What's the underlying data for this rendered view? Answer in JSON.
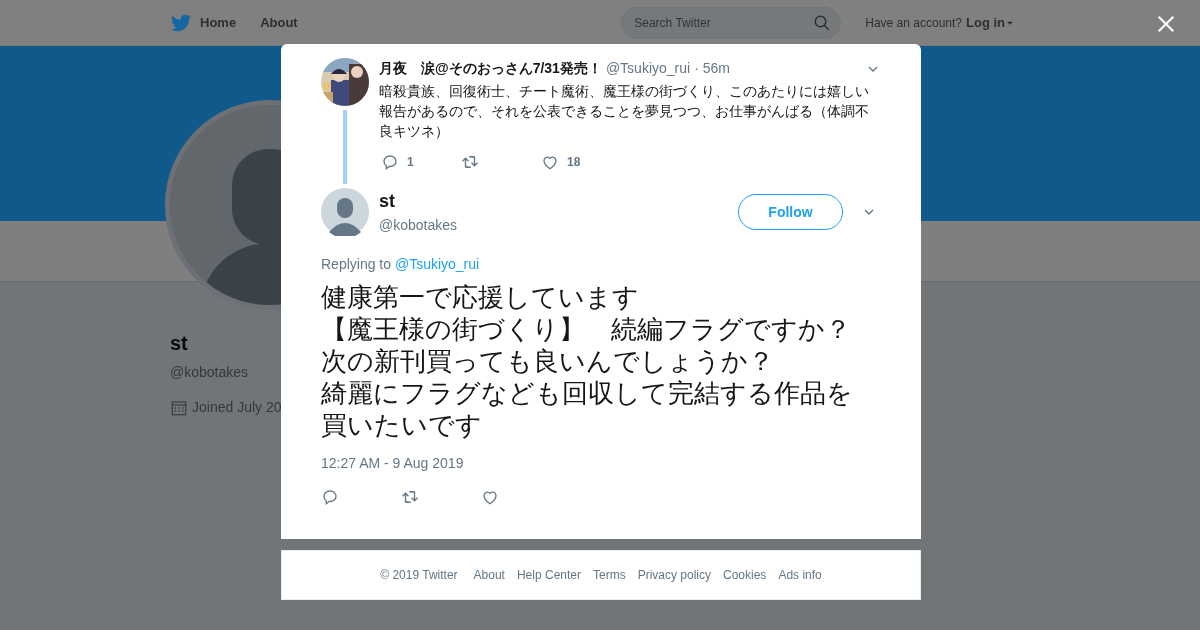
{
  "nav": {
    "items": [
      {
        "label": "Home",
        "kind": "home"
      },
      {
        "label": "About",
        "kind": "plain"
      }
    ],
    "search": {
      "placeholder": "Search Twitter"
    },
    "account": {
      "prompt": "Have an account?",
      "login": "Log in"
    }
  },
  "profile": {
    "name": "st",
    "handle": "@kobotakes",
    "joined": "Joined July 20"
  },
  "parent_tweet": {
    "name": "月夜　涙@そのおっさん7/31発売！",
    "handle": "@Tsukiyo_rui",
    "time": "· 56m",
    "text": "暗殺貴族、回復術士、チート魔術、魔王様の街づくり、このあたりには嬉しい報告があるので、それを公表できることを夢見つつ、お仕事がんばる（体調不良キツネ）",
    "actions": [
      {
        "kind": "reply",
        "count": "1"
      },
      {
        "kind": "retweet"
      },
      {
        "kind": "like",
        "count": "18"
      }
    ]
  },
  "tweet": {
    "name": "st",
    "handle": "@kobotakes",
    "follow": "Follow",
    "replying_label": "Replying to",
    "replying_to": "@Tsukiyo_rui",
    "lines": [
      "健康第一で応援しています",
      "【魔王様の街づくり】　続編フラグですか？",
      "次の新刊買っても良いんでしょうか？",
      "綺麗にフラグなども回収して完結する作品を買いたいです"
    ],
    "timestamp": "12:27 AM - 9 Aug 2019",
    "actions": [
      {
        "kind": "reply"
      },
      {
        "kind": "retweet"
      },
      {
        "kind": "like"
      }
    ]
  },
  "footer": [
    "© 2019 Twitter",
    "About",
    "Help Center",
    "Terms",
    "Privacy policy",
    "Cookies",
    "Ads info"
  ]
}
